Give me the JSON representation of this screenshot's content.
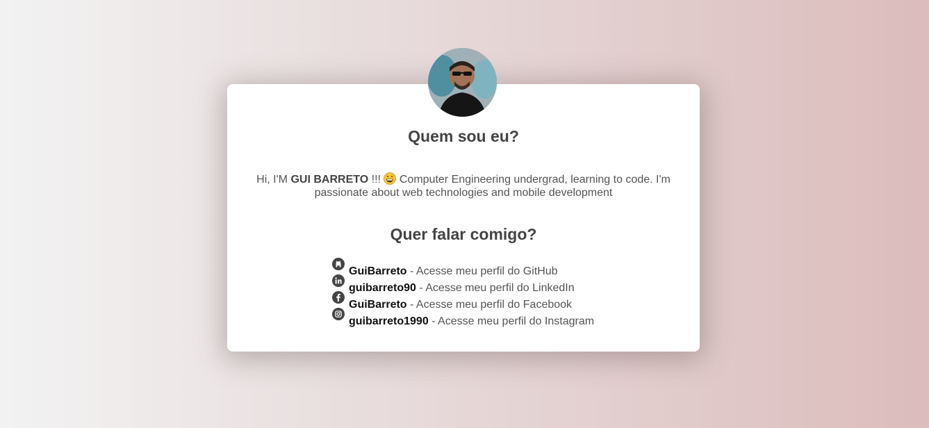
{
  "profile": {
    "avatar_icon": "profile-photo-icon"
  },
  "about": {
    "title": "Quem sou eu?",
    "greeting": "Hi, I'M",
    "name": "GUI BARRETO",
    "exclaim": "!!!",
    "emoji_icon": "grinning-face-icon",
    "description": "Computer Engineering undergrad, learning to code. I'm passionate about web technologies and mobile development"
  },
  "contact": {
    "title": "Quer falar comigo?",
    "links": [
      {
        "icon": "github-icon",
        "handle": "GuiBarreto",
        "text": " - Acesse meu perfil do GitHub"
      },
      {
        "icon": "linkedin-icon",
        "handle": "guibarreto90",
        "text": " - Acesse meu perfil do LinkedIn"
      },
      {
        "icon": "facebook-icon",
        "handle": "GuiBarreto",
        "text": " - Acesse meu perfil do Facebook"
      },
      {
        "icon": "instagram-icon",
        "handle": "guibarreto1990",
        "text": " - Acesse meu perfil do Instagram"
      }
    ]
  },
  "colors": {
    "heading": "#444444",
    "body_text": "#555555",
    "link": "#111111",
    "icon": "#444444"
  }
}
